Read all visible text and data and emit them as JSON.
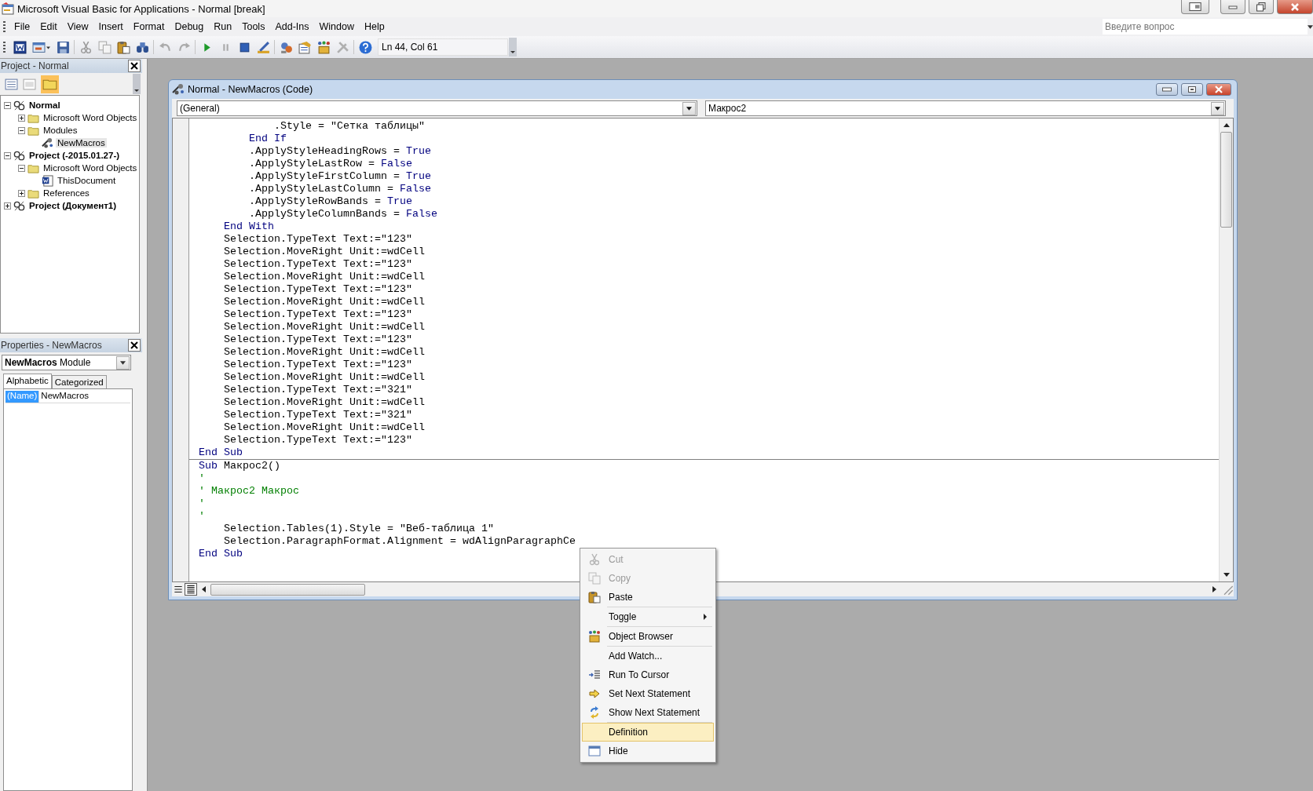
{
  "window": {
    "title": "Microsoft Visual Basic for Applications - Normal [break]"
  },
  "menu": [
    "File",
    "Edit",
    "View",
    "Insert",
    "Format",
    "Debug",
    "Run",
    "Tools",
    "Add-Ins",
    "Window",
    "Help"
  ],
  "help_search": {
    "placeholder": "Введите вопрос"
  },
  "toolbar": {
    "position": "Ln 44, Col 61"
  },
  "project_pane": {
    "title": "Project - Normal",
    "tree": [
      {
        "label": "Normal",
        "kind": "project",
        "expanded": true,
        "selected": false,
        "children": [
          {
            "label": "Microsoft Word Objects",
            "kind": "folder",
            "expanded": false,
            "selected": false
          },
          {
            "label": "Modules",
            "kind": "folder",
            "expanded": true,
            "selected": false,
            "children": [
              {
                "label": "NewMacros",
                "kind": "module",
                "selected": true
              }
            ]
          }
        ]
      },
      {
        "label": "Project (-2015.01.27-)",
        "kind": "project",
        "expanded": true,
        "selected": false,
        "children": [
          {
            "label": "Microsoft Word Objects",
            "kind": "folder",
            "expanded": true,
            "selected": false,
            "children": [
              {
                "label": "ThisDocument",
                "kind": "document",
                "selected": false
              }
            ]
          },
          {
            "label": "References",
            "kind": "folder",
            "expanded": false,
            "selected": false
          }
        ]
      },
      {
        "label": "Project (Документ1)",
        "kind": "project",
        "expanded": false,
        "selected": false
      }
    ]
  },
  "properties_pane": {
    "title": "Properties - NewMacros",
    "object": {
      "name": "NewMacros",
      "type": "Module"
    },
    "tabs": [
      {
        "label": "Alphabetic",
        "selected": true
      },
      {
        "label": "Categorized",
        "selected": false
      }
    ],
    "rows": [
      {
        "name": "(Name)",
        "value": "NewMacros",
        "selected": true
      }
    ]
  },
  "code_window": {
    "title": "Normal - NewMacros (Code)",
    "object_box": "(General)",
    "procedure_box": "Макрос2",
    "procedures": [
      {
        "lines": [
          [
            {
              "text": "            .Style = \"Сетка таблицы\"",
              "kind": "plain"
            }
          ],
          [
            {
              "text": "        End If",
              "kind": "keyword"
            }
          ],
          [
            {
              "text": "        .ApplyStyleHeadingRows = ",
              "kind": "plain"
            },
            {
              "text": "True",
              "kind": "keyword"
            }
          ],
          [
            {
              "text": "        .ApplyStyleLastRow = ",
              "kind": "plain"
            },
            {
              "text": "False",
              "kind": "keyword"
            }
          ],
          [
            {
              "text": "        .ApplyStyleFirstColumn = ",
              "kind": "plain"
            },
            {
              "text": "True",
              "kind": "keyword"
            }
          ],
          [
            {
              "text": "        .ApplyStyleLastColumn = ",
              "kind": "plain"
            },
            {
              "text": "False",
              "kind": "keyword"
            }
          ],
          [
            {
              "text": "        .ApplyStyleRowBands = ",
              "kind": "plain"
            },
            {
              "text": "True",
              "kind": "keyword"
            }
          ],
          [
            {
              "text": "        .ApplyStyleColumnBands = ",
              "kind": "plain"
            },
            {
              "text": "False",
              "kind": "keyword"
            }
          ],
          [
            {
              "text": "    End With",
              "kind": "keyword"
            }
          ],
          [
            {
              "text": "    Selection.TypeText Text:=\"123\"",
              "kind": "plain"
            }
          ],
          [
            {
              "text": "    Selection.MoveRight Unit:=wdCell",
              "kind": "plain"
            }
          ],
          [
            {
              "text": "    Selection.TypeText Text:=\"123\"",
              "kind": "plain"
            }
          ],
          [
            {
              "text": "    Selection.MoveRight Unit:=wdCell",
              "kind": "plain"
            }
          ],
          [
            {
              "text": "    Selection.TypeText Text:=\"123\"",
              "kind": "plain"
            }
          ],
          [
            {
              "text": "    Selection.MoveRight Unit:=wdCell",
              "kind": "plain"
            }
          ],
          [
            {
              "text": "    Selection.TypeText Text:=\"123\"",
              "kind": "plain"
            }
          ],
          [
            {
              "text": "    Selection.MoveRight Unit:=wdCell",
              "kind": "plain"
            }
          ],
          [
            {
              "text": "    Selection.TypeText Text:=\"123\"",
              "kind": "plain"
            }
          ],
          [
            {
              "text": "    Selection.MoveRight Unit:=wdCell",
              "kind": "plain"
            }
          ],
          [
            {
              "text": "    Selection.TypeText Text:=\"123\"",
              "kind": "plain"
            }
          ],
          [
            {
              "text": "    Selection.MoveRight Unit:=wdCell",
              "kind": "plain"
            }
          ],
          [
            {
              "text": "    Selection.TypeText Text:=\"321\"",
              "kind": "plain"
            }
          ],
          [
            {
              "text": "    Selection.MoveRight Unit:=wdCell",
              "kind": "plain"
            }
          ],
          [
            {
              "text": "    Selection.TypeText Text:=\"321\"",
              "kind": "plain"
            }
          ],
          [
            {
              "text": "    Selection.MoveRight Unit:=wdCell",
              "kind": "plain"
            }
          ],
          [
            {
              "text": "    Selection.TypeText Text:=\"123\"",
              "kind": "plain"
            }
          ],
          [
            {
              "text": "End Sub",
              "kind": "keyword"
            }
          ]
        ]
      },
      {
        "lines": [
          [
            {
              "text": "Sub",
              "kind": "keyword"
            },
            {
              "text": " Макрос2()",
              "kind": "plain"
            }
          ],
          [
            {
              "text": "'",
              "kind": "comment"
            }
          ],
          [
            {
              "text": "' Макрос2 Макрос",
              "kind": "comment"
            }
          ],
          [
            {
              "text": "'",
              "kind": "comment"
            }
          ],
          [
            {
              "text": "'",
              "kind": "comment"
            }
          ],
          [
            {
              "text": "    Selection.Tables(1).Style = \"Веб-таблица 1\"",
              "kind": "plain"
            }
          ],
          [
            {
              "text": "    Selection.ParagraphFormat.Alignment = wdAlignParagraphCe",
              "kind": "plain"
            }
          ],
          [
            {
              "text": "End Sub",
              "kind": "keyword"
            }
          ]
        ]
      }
    ]
  },
  "context_menu": {
    "groups": [
      [
        {
          "label": "Cut",
          "disabled": true,
          "selected": false,
          "submenu": false
        },
        {
          "label": "Copy",
          "disabled": true,
          "selected": false,
          "submenu": false
        },
        {
          "label": "Paste",
          "disabled": false,
          "selected": false,
          "submenu": false
        }
      ],
      [
        {
          "label": "Toggle",
          "disabled": false,
          "selected": false,
          "submenu": true
        }
      ],
      [
        {
          "label": "Object Browser",
          "disabled": false,
          "selected": false,
          "submenu": false
        }
      ],
      [
        {
          "label": "Add Watch...",
          "disabled": false,
          "selected": false,
          "submenu": false
        },
        {
          "label": "Run To Cursor",
          "disabled": false,
          "selected": false,
          "submenu": false
        },
        {
          "label": "Set Next Statement",
          "disabled": false,
          "selected": false,
          "submenu": false
        },
        {
          "label": "Show Next Statement",
          "disabled": false,
          "selected": false,
          "submenu": false
        }
      ],
      [
        {
          "label": "Definition",
          "disabled": false,
          "selected": true,
          "submenu": false
        },
        {
          "label": "Hide",
          "disabled": false,
          "selected": false,
          "submenu": false
        }
      ]
    ]
  }
}
